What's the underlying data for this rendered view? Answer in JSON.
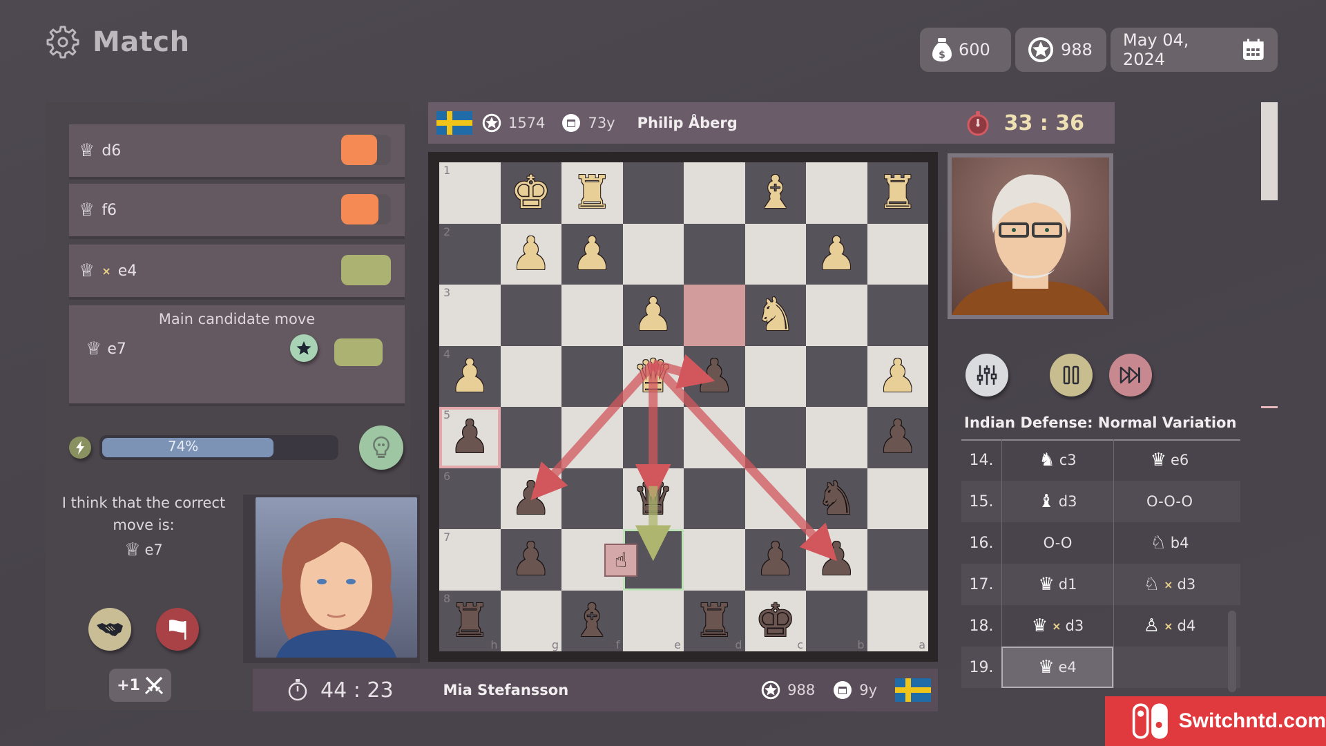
{
  "header": {
    "title": "Match",
    "coins": "600",
    "rating": "988",
    "date": "May 04, 2024"
  },
  "candidates": [
    {
      "piece": "queen",
      "capture": false,
      "square": "d6",
      "indicator_color": "#f58a55",
      "indicator_fill": 0.72
    },
    {
      "piece": "queen",
      "capture": false,
      "square": "f6",
      "indicator_color": "#f58a55",
      "indicator_fill": 0.75
    },
    {
      "piece": "queen",
      "capture": true,
      "capture_mark": "×",
      "square": "e4",
      "indicator_color": "#acb272",
      "indicator_fill": 1.0
    }
  ],
  "main_candidate": {
    "label": "Main candidate move",
    "square": "e7",
    "indicator_color": "#acb272"
  },
  "analysis": {
    "progress": 0.74,
    "progress_label": "74%"
  },
  "suggestion": {
    "text": "I think that the correct move is:",
    "square": "e7"
  },
  "actions": {
    "bonus_label": "+1"
  },
  "opponent": {
    "name": "Philip Åberg",
    "rating": "1574",
    "age": "73y",
    "clock": "33 : 36",
    "country": "Sweden"
  },
  "player": {
    "name": "Mia Stefansson",
    "rating": "988",
    "age": "9y",
    "clock": "44 : 23",
    "country": "Sweden"
  },
  "board": {
    "orientation": "black-bottom",
    "rank_labels": [
      "1",
      "2",
      "3",
      "4",
      "5",
      "6",
      "7",
      "8"
    ],
    "file_labels": [
      "h",
      "g",
      "f",
      "e",
      "d",
      "c",
      "b",
      "a"
    ],
    "rows": [
      [
        "",
        "wK",
        "wR",
        "",
        "",
        "wB",
        "",
        "wR"
      ],
      [
        "",
        "wP",
        "wP",
        "",
        "",
        "",
        "wP",
        ""
      ],
      [
        "",
        "",
        "",
        "wP",
        "",
        "wN",
        "",
        ""
      ],
      [
        "wP",
        "",
        "",
        "wQ",
        "bP",
        "",
        "",
        "wP"
      ],
      [
        "bP",
        "",
        "",
        "",
        "",
        "",
        "",
        "bP"
      ],
      [
        "",
        "bP",
        "",
        "bQ",
        "",
        "",
        "bN",
        ""
      ],
      [
        "",
        "bP",
        "",
        "",
        "",
        "bP",
        "bP",
        ""
      ],
      [
        "bR",
        "",
        "bB",
        "",
        "bR",
        "bK",
        "",
        ""
      ]
    ],
    "highlight_last_move": "d3",
    "highlight_threat": "h5",
    "highlight_target": "e7",
    "threat_arrows": [
      {
        "from": "e4",
        "to": "d4"
      },
      {
        "from": "e4",
        "to": "g6"
      },
      {
        "from": "e4",
        "to": "e6"
      },
      {
        "from": "e4",
        "to": "b7"
      }
    ],
    "suggested_arrow": {
      "from": "e6",
      "to": "e7"
    }
  },
  "controls": {
    "settings": "settings",
    "pause": "pause",
    "skip": "fast-forward"
  },
  "opening_name": "Indian Defense: Normal Variation",
  "moves": [
    {
      "num": "14.",
      "white": {
        "piece": "knight",
        "capture": false,
        "sq": "c3"
      },
      "black": {
        "piece": "queen",
        "capture": false,
        "sq": "e6"
      }
    },
    {
      "num": "15.",
      "white": {
        "piece": "bishop",
        "capture": false,
        "sq": "d3"
      },
      "black": {
        "piece": "",
        "capture": false,
        "sq": "O-O-O"
      }
    },
    {
      "num": "16.",
      "white": {
        "piece": "",
        "capture": false,
        "sq": "O-O"
      },
      "black": {
        "piece": "knight-outline",
        "capture": false,
        "sq": "b4"
      }
    },
    {
      "num": "17.",
      "white": {
        "piece": "queen",
        "capture": false,
        "sq": "d1"
      },
      "black": {
        "piece": "knight-outline",
        "capture": true,
        "sq": "d3"
      }
    },
    {
      "num": "18.",
      "white": {
        "piece": "queen",
        "capture": true,
        "sq": "d3"
      },
      "black": {
        "piece": "pawn-outline",
        "capture": true,
        "sq": "d4"
      }
    },
    {
      "num": "19.",
      "white": {
        "piece": "queen",
        "capture": false,
        "sq": "e4",
        "selected": true
      },
      "black": null
    }
  ],
  "watermark": "Switchntd.com"
}
